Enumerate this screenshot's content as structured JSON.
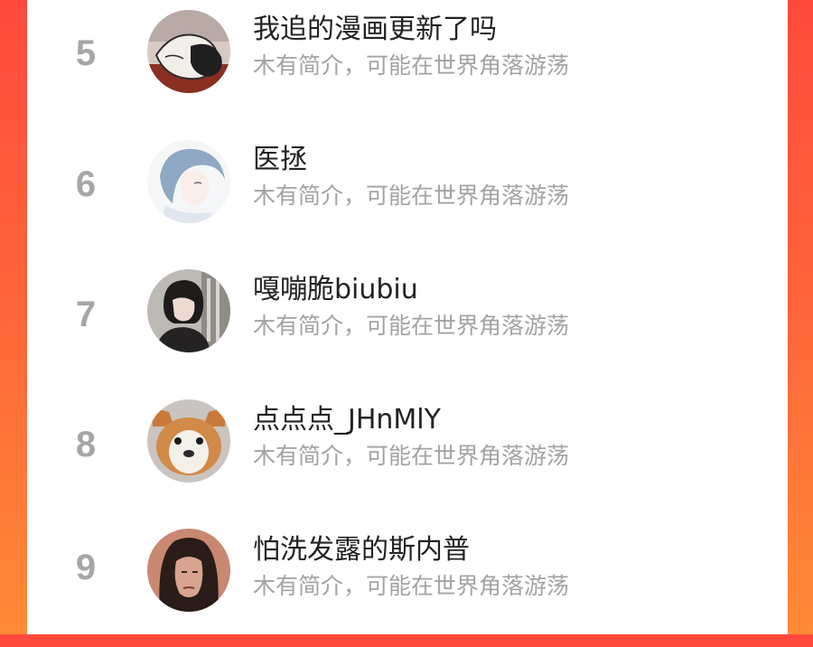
{
  "colors": {
    "background_top": "#ff4a3c",
    "background_bottom": "#ff8a36",
    "rank_color": "#a6a6a6",
    "name_color": "#222222",
    "bio_color": "#a3a3a3"
  },
  "list": {
    "items": [
      {
        "rank": "5",
        "name": "我追的漫画更新了吗",
        "bio": "木有简介，可能在世界角落游荡",
        "avatar_icon": "anime-sleeping-avatar"
      },
      {
        "rank": "6",
        "name": "医拯",
        "bio": "木有简介，可能在世界角落游荡",
        "avatar_icon": "anime-girl-avatar"
      },
      {
        "rank": "7",
        "name": "嘎嘣脆biubiu",
        "bio": "木有简介，可能在世界角落游荡",
        "avatar_icon": "woman-photo-avatar"
      },
      {
        "rank": "8",
        "name": "点点点_JHnMlY",
        "bio": "木有简介，可能在世界角落游荡",
        "avatar_icon": "dog-photo-avatar"
      },
      {
        "rank": "9",
        "name": "怕洗发露的斯内普",
        "bio": "木有简介，可能在世界角落游荡",
        "avatar_icon": "man-portrait-avatar"
      }
    ]
  }
}
